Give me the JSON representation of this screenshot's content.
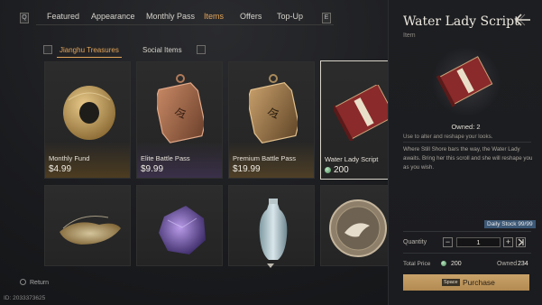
{
  "nav": {
    "left_key": "Q",
    "right_key": "E",
    "tabs": [
      {
        "label": "Featured"
      },
      {
        "label": "Appearance"
      },
      {
        "label": "Monthly Pass"
      },
      {
        "label": "Items",
        "active": true
      },
      {
        "label": "Offers"
      },
      {
        "label": "Top-Up"
      }
    ]
  },
  "subtabs": [
    {
      "label": "Jianghu Treasures",
      "active": true
    },
    {
      "label": "Social Items"
    }
  ],
  "cards": [
    {
      "name": "Monthly Fund",
      "price": "$4.99",
      "currency": "usd",
      "art": "jade-disc"
    },
    {
      "name": "Elite Battle Pass",
      "price": "$9.99",
      "currency": "usd",
      "art": "bronze-token"
    },
    {
      "name": "Premium Battle Pass",
      "price": "$19.99",
      "currency": "usd",
      "art": "gold-token"
    },
    {
      "name": "Water Lady Script",
      "price": "200",
      "currency": "jade",
      "art": "red-scroll",
      "selected": true
    },
    {
      "name": "",
      "price": "",
      "art": "golden-ingot"
    },
    {
      "name": "",
      "price": "",
      "art": "violet-ore"
    },
    {
      "name": "",
      "price": "",
      "art": "porcelain-vase"
    },
    {
      "name": "",
      "price": "",
      "art": "crane-medallion"
    }
  ],
  "footer": {
    "return_label": "Return",
    "uid": "ID: 2033373625"
  },
  "detail": {
    "title": "Water Lady Script",
    "type": "Item",
    "owned": "Owned: 2",
    "use": "Use to alter and reshape your looks.",
    "lore": "Where Still Shore bars the way, the Water Lady awaits. Bring her this scroll and she will reshape you as you wish.",
    "daily_stock": "Daily Stock 99/99",
    "quantity_label": "Quantity",
    "quantity": "1",
    "total_label": "Total Price",
    "total_value": "200",
    "owned_label": "Owned",
    "owned_value": "234",
    "purchase_key": "Space",
    "purchase_label": "Purchase"
  },
  "colors": {
    "accent": "#e3a55a",
    "purchase": "#c9a36a",
    "stock_badge": "#3c5876"
  }
}
